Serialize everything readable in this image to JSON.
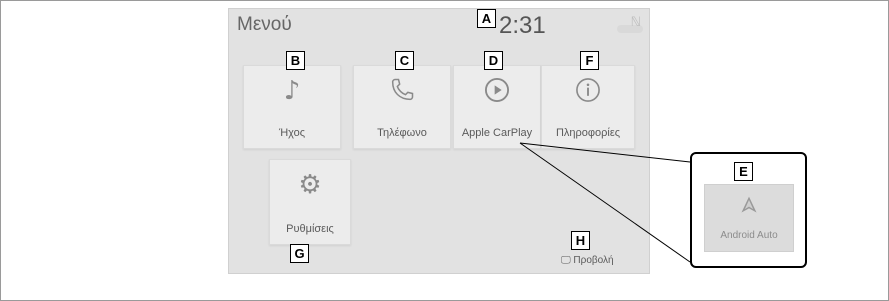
{
  "header": {
    "menu_label": "Μενού",
    "time": "2:31"
  },
  "tiles": [
    {
      "id": "audio",
      "label": "Ήχος",
      "icon": "music-note-icon"
    },
    {
      "id": "phone",
      "label": "Τηλέφωνο",
      "icon": "phone-icon"
    },
    {
      "id": "carplay",
      "label": "Apple CarPlay",
      "icon": "play-circle-icon"
    },
    {
      "id": "info",
      "label": "Πληροφορίες",
      "icon": "info-icon"
    },
    {
      "id": "settings",
      "label": "Ρυθμίσεις",
      "icon": "gear-icon"
    }
  ],
  "view_button": {
    "label": "Προβολή",
    "icon": "screen-icon"
  },
  "callout": {
    "tile_label": "Android Auto",
    "icon": "android-auto-icon"
  },
  "markers": {
    "A": "A",
    "B": "B",
    "C": "C",
    "D": "D",
    "E": "E",
    "F": "F",
    "G": "G",
    "H": "H"
  }
}
